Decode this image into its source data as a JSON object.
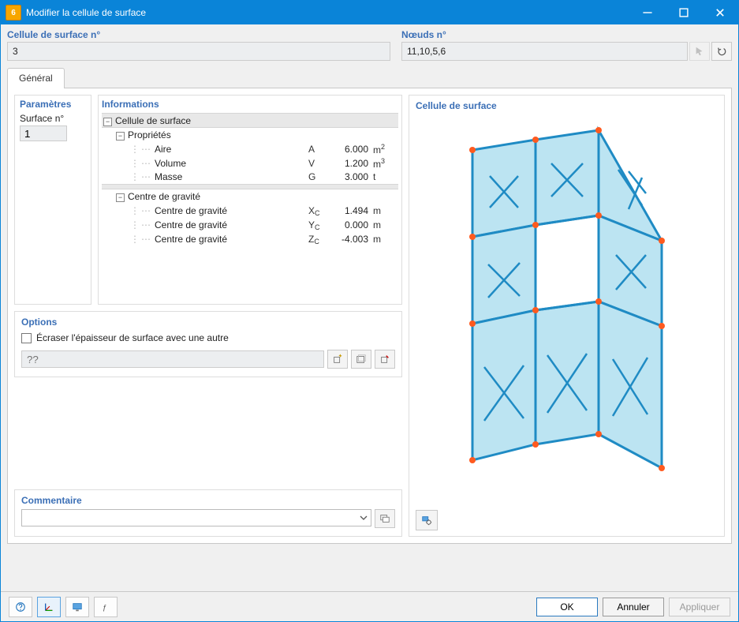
{
  "window": {
    "title": "Modifier la cellule de surface"
  },
  "header": {
    "cell_label": "Cellule de surface n°",
    "cell_value": "3",
    "nodes_label": "Nœuds n°",
    "nodes_value": "11,10,5,6"
  },
  "tabs": {
    "general": "Général"
  },
  "parameters": {
    "title": "Paramètres",
    "surface_label": "Surface n°",
    "surface_value": "1"
  },
  "info": {
    "title": "Informations",
    "root": "Cellule de surface",
    "props_header": "Propriétés",
    "props": [
      {
        "label": "Aire",
        "sym": "A",
        "value": "6.000",
        "unit_html": "m<sup>2</sup>"
      },
      {
        "label": "Volume",
        "sym": "V",
        "value": "1.200",
        "unit_html": "m<sup>3</sup>"
      },
      {
        "label": "Masse",
        "sym": "G",
        "value": "3.000",
        "unit_html": "t"
      }
    ],
    "cog_header": "Centre de gravité",
    "cog": [
      {
        "label": "Centre de gravité",
        "sym_html": "X<sub>C</sub>",
        "value": "1.494",
        "unit": "m"
      },
      {
        "label": "Centre de gravité",
        "sym_html": "Y<sub>C</sub>",
        "value": "0.000",
        "unit": "m"
      },
      {
        "label": "Centre de gravité",
        "sym_html": "Z<sub>C</sub>",
        "value": "-4.003",
        "unit": "m"
      }
    ]
  },
  "options": {
    "title": "Options",
    "overwrite_label": "Écraser l'épaisseur de surface avec une autre",
    "thickness_value": "??"
  },
  "comment": {
    "title": "Commentaire",
    "value": ""
  },
  "preview": {
    "title": "Cellule de surface"
  },
  "buttons": {
    "ok": "OK",
    "cancel": "Annuler",
    "apply": "Appliquer"
  },
  "colors": {
    "accent": "#0a84d8",
    "panel_title": "#3b6fb6",
    "surface_fill": "#bce4f2",
    "surface_stroke": "#1f8bc4",
    "node": "#ff5a1f"
  }
}
